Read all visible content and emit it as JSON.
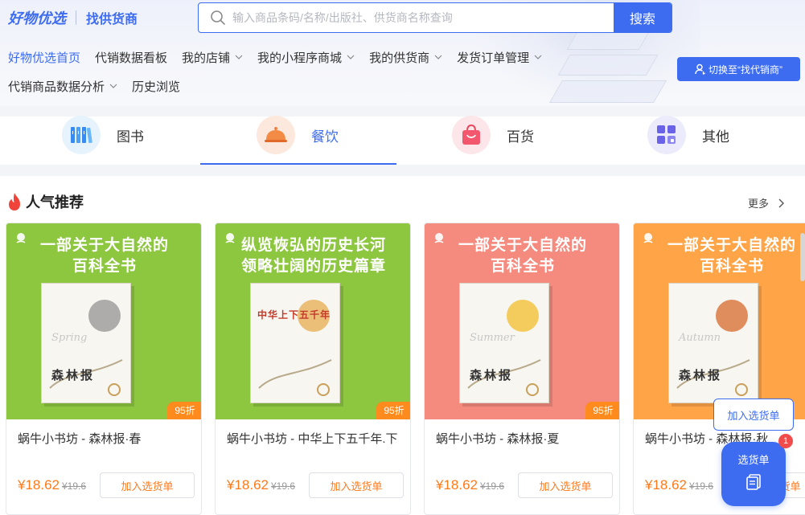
{
  "header": {
    "logo_main": "好物优选",
    "logo_sub": "找供货商",
    "search_placeholder": "输入商品条码/名称/出版社、供货商名称查询",
    "search_button": "搜索",
    "switch_button": "切换至“找代销商”"
  },
  "nav": {
    "row1": [
      {
        "label": "好物优选首页",
        "active": true,
        "dropdown": false
      },
      {
        "label": "代销数据看板",
        "active": false,
        "dropdown": false
      },
      {
        "label": "我的店铺",
        "active": false,
        "dropdown": true
      },
      {
        "label": "我的小程序商城",
        "active": false,
        "dropdown": true
      },
      {
        "label": "我的供货商",
        "active": false,
        "dropdown": true
      },
      {
        "label": "发货订单管理",
        "active": false,
        "dropdown": true
      }
    ],
    "row2": [
      {
        "label": "代销商品数据分析",
        "active": false,
        "dropdown": true
      },
      {
        "label": "历史浏览",
        "active": false,
        "dropdown": false
      }
    ]
  },
  "categories": [
    {
      "label": "图书",
      "icon": "books-icon",
      "active": false
    },
    {
      "label": "餐饮",
      "icon": "food-cloche-icon",
      "active": true
    },
    {
      "label": "百货",
      "icon": "shopping-bag-icon",
      "active": false
    },
    {
      "label": "其他",
      "icon": "grid-apps-icon",
      "active": false
    }
  ],
  "section": {
    "title": "人气推荐",
    "more": "更多"
  },
  "products": [
    {
      "headline1": "一部关于大自然的",
      "headline2": "百科全书",
      "book_title": "森林报",
      "season": "Spring",
      "bg": "#8dc63f",
      "discount": "95折",
      "name": "蜗牛小书坊 - 森林报·春",
      "price": "¥18.62",
      "orig_price": "¥19.6",
      "add_label": "加入选货单"
    },
    {
      "headline1": "纵览恢弘的历史长河",
      "headline2": "领略壮阔的历史篇章",
      "book_title": "中华上下五千年",
      "season": "",
      "bg": "#8dc63f",
      "discount": "95折",
      "name": "蜗牛小书坊 - 中华上下五千年.下",
      "price": "¥18.62",
      "orig_price": "¥19.6",
      "add_label": "加入选货单"
    },
    {
      "headline1": "一部关于大自然的",
      "headline2": "百科全书",
      "book_title": "森林报",
      "season": "Summer",
      "bg": "#f58a7e",
      "discount": "95折",
      "name": "蜗牛小书坊 - 森林报·夏",
      "price": "¥18.62",
      "orig_price": "¥19.6",
      "add_label": "加入选货单"
    },
    {
      "headline1": "一部关于大自然的",
      "headline2": "百科全书",
      "book_title": "森林报",
      "season": "Autumn",
      "bg": "#ffa447",
      "discount": "",
      "name": "蜗牛小书坊 - 森林报·秋",
      "price": "¥18.62",
      "orig_price": "¥19.6",
      "add_label": "加入选货单"
    }
  ],
  "floating": {
    "add_label": "加入选货单",
    "cart_label": "选货单",
    "cart_count": "1"
  },
  "colors": {
    "brand": "#3d6cf0",
    "price": "#ff7a1a",
    "discount_bg": "#ff8a1d",
    "badge": "#f04c4c"
  }
}
